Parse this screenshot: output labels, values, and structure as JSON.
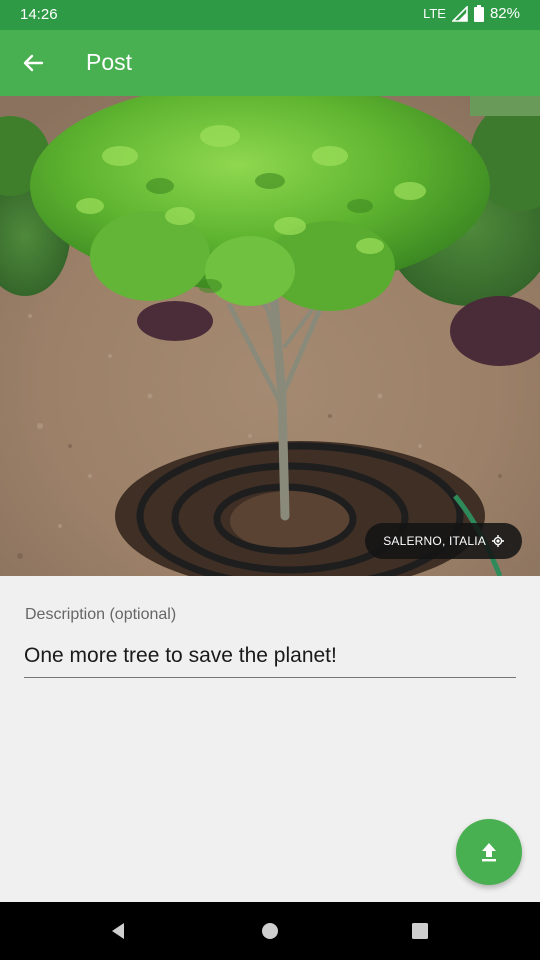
{
  "status_bar": {
    "time": "14:26",
    "network": "LTE",
    "battery": "82%"
  },
  "app_bar": {
    "title": "Post",
    "back_icon": "arrow-back-icon"
  },
  "photo": {
    "location": "SALERNO, ITALIA",
    "location_icon": "my-location-icon"
  },
  "description": {
    "label": "Description (optional)",
    "value": "One more tree to save the planet!"
  },
  "fab": {
    "icon": "upload-icon"
  },
  "nav_bar": {
    "back_icon": "nav-back-icon",
    "home_icon": "nav-home-icon",
    "recents_icon": "nav-recents-icon"
  },
  "colors": {
    "status_bar": "#2e9a45",
    "app_bar": "#49b051",
    "fab": "#49b051",
    "background": "#f0f0f0"
  }
}
